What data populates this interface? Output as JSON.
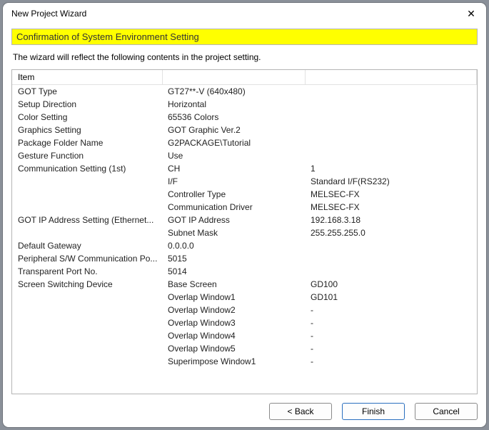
{
  "window": {
    "title": "New Project Wizard"
  },
  "section": {
    "header": "Confirmation of System Environment Setting"
  },
  "intro": "The wizard will reflect the following contents in the project setting.",
  "header": {
    "col0": "Item",
    "col1": "",
    "col2": ""
  },
  "rows": [
    {
      "c0": "GOT Type",
      "c1": "GT27**-V (640x480)",
      "c2": ""
    },
    {
      "c0": "Setup Direction",
      "c1": "Horizontal",
      "c2": ""
    },
    {
      "c0": "Color Setting",
      "c1": "65536 Colors",
      "c2": ""
    },
    {
      "c0": "Graphics Setting",
      "c1": "GOT Graphic Ver.2",
      "c2": ""
    },
    {
      "c0": "Package Folder Name",
      "c1": "G2PACKAGE\\Tutorial",
      "c2": ""
    },
    {
      "c0": "Gesture Function",
      "c1": "Use",
      "c2": ""
    },
    {
      "c0": "Communication Setting (1st)",
      "c1": "CH",
      "c2": "1"
    },
    {
      "c0": "",
      "c1": "I/F",
      "c2": "Standard I/F(RS232)"
    },
    {
      "c0": "",
      "c1": "Controller Type",
      "c2": "MELSEC-FX"
    },
    {
      "c0": "",
      "c1": "Communication Driver",
      "c2": "MELSEC-FX"
    },
    {
      "c0": "GOT IP Address Setting (Ethernet...",
      "c1": "GOT IP Address",
      "c2": "192.168.3.18"
    },
    {
      "c0": "",
      "c1": "Subnet Mask",
      "c2": "255.255.255.0"
    },
    {
      "c0": "Default Gateway",
      "c1": "0.0.0.0",
      "c2": ""
    },
    {
      "c0": "Peripheral S/W Communication Po...",
      "c1": "5015",
      "c2": ""
    },
    {
      "c0": "Transparent Port No.",
      "c1": "5014",
      "c2": ""
    },
    {
      "c0": "Screen Switching Device",
      "c1": "Base Screen",
      "c2": "GD100"
    },
    {
      "c0": "",
      "c1": "Overlap Window1",
      "c2": "GD101"
    },
    {
      "c0": "",
      "c1": "Overlap Window2",
      "c2": "-"
    },
    {
      "c0": "",
      "c1": "Overlap Window3",
      "c2": "-"
    },
    {
      "c0": "",
      "c1": "Overlap Window4",
      "c2": "-"
    },
    {
      "c0": "",
      "c1": "Overlap Window5",
      "c2": "-"
    },
    {
      "c0": "",
      "c1": "Superimpose Window1",
      "c2": "-"
    }
  ],
  "buttons": {
    "back": "< Back",
    "finish": "Finish",
    "cancel": "Cancel"
  }
}
